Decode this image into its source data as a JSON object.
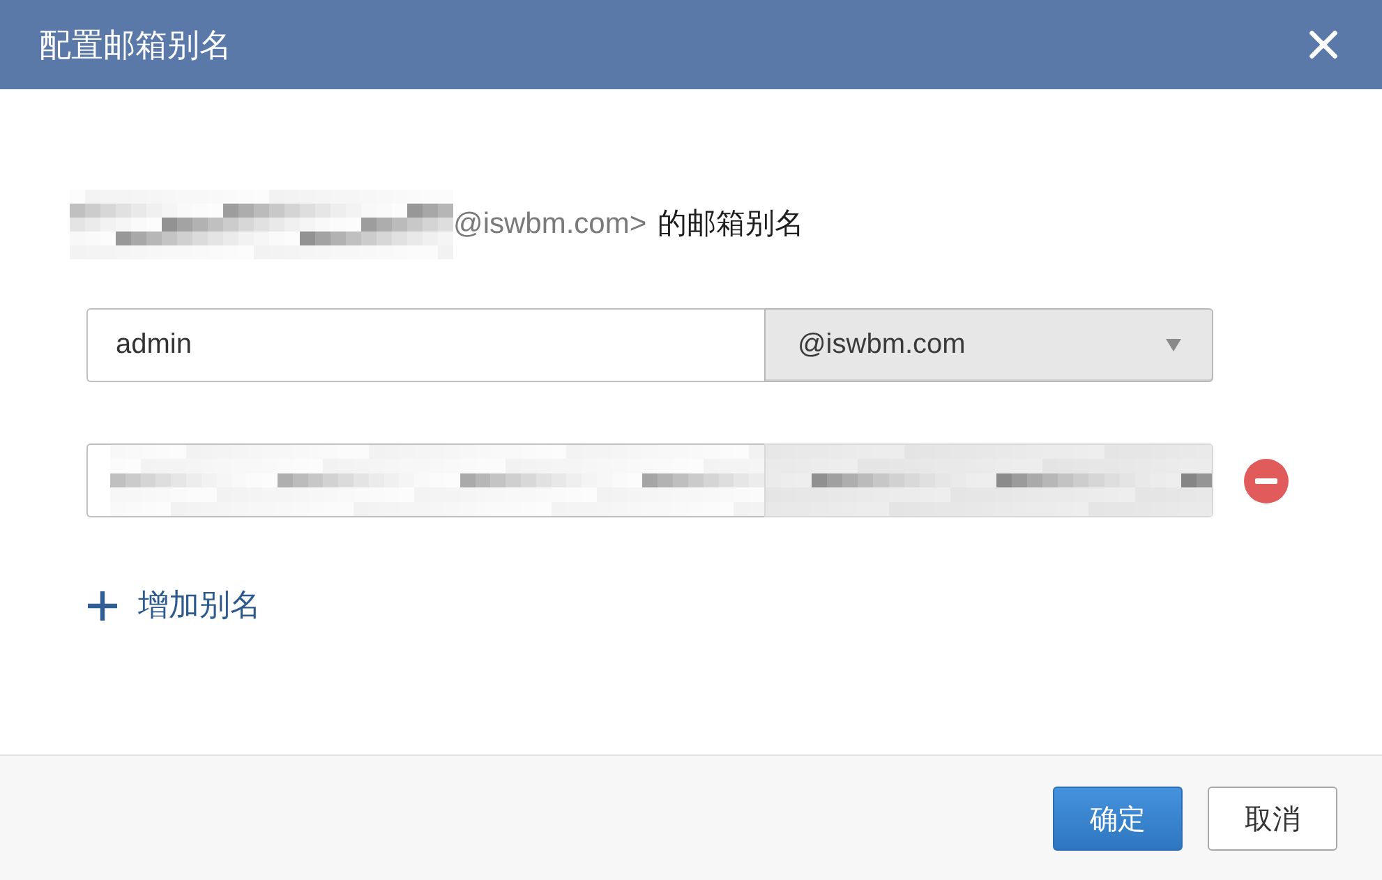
{
  "dialog": {
    "title": "配置邮箱别名"
  },
  "heading": {
    "address_end": "@iswbm.com>",
    "suffix": "的邮箱别名"
  },
  "aliases": [
    {
      "kind": "text",
      "name": "admin",
      "domain": "@iswbm.com",
      "removable": false
    },
    {
      "kind": "redacted",
      "removable": true
    }
  ],
  "add_alias": {
    "label": "增加别名"
  },
  "buttons": [
    {
      "label": "确定",
      "kind": "primary"
    },
    {
      "label": "取消",
      "kind": "default"
    }
  ]
}
